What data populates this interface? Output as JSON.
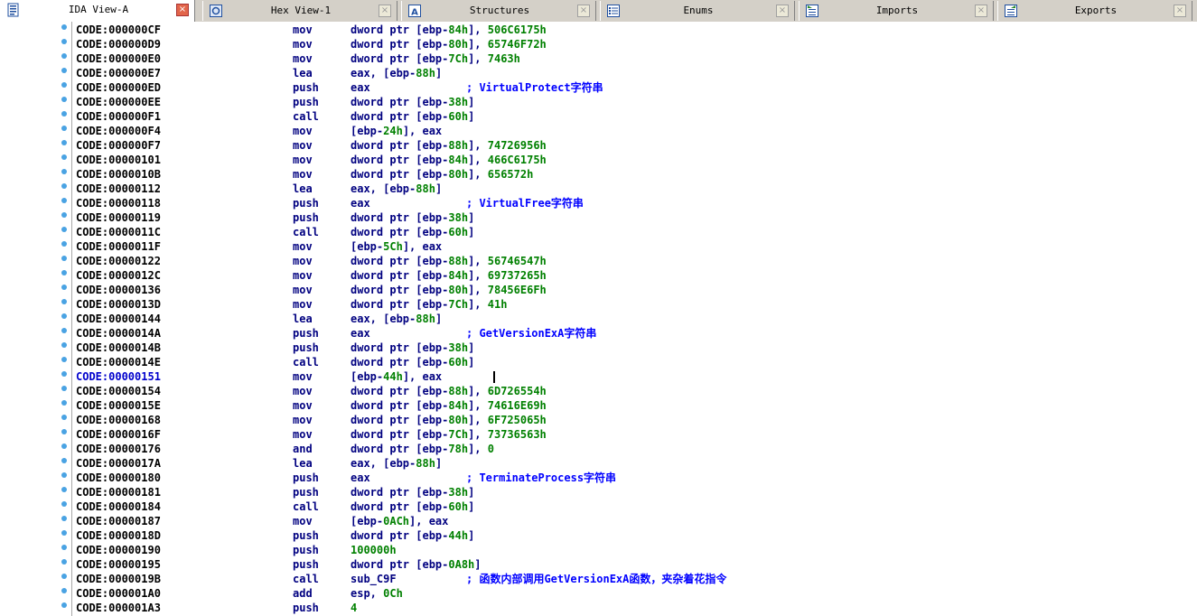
{
  "tabs": [
    {
      "label": "IDA View-A",
      "icon": "ida-view-icon",
      "active": true
    },
    {
      "label": "Hex View-1",
      "icon": "hex-view-icon",
      "active": false
    },
    {
      "label": "Structures",
      "icon": "structures-icon",
      "active": false
    },
    {
      "label": "Enums",
      "icon": "enums-icon",
      "active": false
    },
    {
      "label": "Imports",
      "icon": "imports-icon",
      "active": false
    },
    {
      "label": "Exports",
      "icon": "exports-icon",
      "active": false
    }
  ],
  "close_glyph": "×",
  "colors": {
    "address": "#000000",
    "selected_address": "#0000cc",
    "mnemonic": "#000080",
    "number": "#008000",
    "comment": "#0000ff",
    "bullet": "#4aa3e3"
  },
  "selected_row": 24,
  "rows": [
    {
      "addr": "CODE:000000CF",
      "mnem": "mov",
      "ops": [
        {
          "t": "dword ptr [ebp-",
          "k": "kw"
        },
        {
          "t": "84h",
          "k": "num"
        },
        {
          "t": "], ",
          "k": "kw"
        },
        {
          "t": "506C6175h",
          "k": "num"
        }
      ],
      "cmt": ""
    },
    {
      "addr": "CODE:000000D9",
      "mnem": "mov",
      "ops": [
        {
          "t": "dword ptr [ebp-",
          "k": "kw"
        },
        {
          "t": "80h",
          "k": "num"
        },
        {
          "t": "], ",
          "k": "kw"
        },
        {
          "t": "65746F72h",
          "k": "num"
        }
      ],
      "cmt": ""
    },
    {
      "addr": "CODE:000000E0",
      "mnem": "mov",
      "ops": [
        {
          "t": "dword ptr [ebp-",
          "k": "kw"
        },
        {
          "t": "7Ch",
          "k": "num"
        },
        {
          "t": "], ",
          "k": "kw"
        },
        {
          "t": "7463h",
          "k": "num"
        }
      ],
      "cmt": ""
    },
    {
      "addr": "CODE:000000E7",
      "mnem": "lea",
      "ops": [
        {
          "t": "eax, [ebp-",
          "k": "kw"
        },
        {
          "t": "88h",
          "k": "num"
        },
        {
          "t": "]",
          "k": "kw"
        }
      ],
      "cmt": ""
    },
    {
      "addr": "CODE:000000ED",
      "mnem": "push",
      "ops": [
        {
          "t": "eax",
          "k": "kw"
        }
      ],
      "cmt": "; VirtualProtect字符串"
    },
    {
      "addr": "CODE:000000EE",
      "mnem": "push",
      "ops": [
        {
          "t": "dword ptr [ebp-",
          "k": "kw"
        },
        {
          "t": "38h",
          "k": "num"
        },
        {
          "t": "]",
          "k": "kw"
        }
      ],
      "cmt": ""
    },
    {
      "addr": "CODE:000000F1",
      "mnem": "call",
      "ops": [
        {
          "t": "dword ptr [ebp-",
          "k": "kw"
        },
        {
          "t": "60h",
          "k": "num"
        },
        {
          "t": "]",
          "k": "kw"
        }
      ],
      "cmt": ""
    },
    {
      "addr": "CODE:000000F4",
      "mnem": "mov",
      "ops": [
        {
          "t": "[ebp-",
          "k": "kw"
        },
        {
          "t": "24h",
          "k": "num"
        },
        {
          "t": "], eax",
          "k": "kw"
        }
      ],
      "cmt": ""
    },
    {
      "addr": "CODE:000000F7",
      "mnem": "mov",
      "ops": [
        {
          "t": "dword ptr [ebp-",
          "k": "kw"
        },
        {
          "t": "88h",
          "k": "num"
        },
        {
          "t": "], ",
          "k": "kw"
        },
        {
          "t": "74726956h",
          "k": "num"
        }
      ],
      "cmt": ""
    },
    {
      "addr": "CODE:00000101",
      "mnem": "mov",
      "ops": [
        {
          "t": "dword ptr [ebp-",
          "k": "kw"
        },
        {
          "t": "84h",
          "k": "num"
        },
        {
          "t": "], ",
          "k": "kw"
        },
        {
          "t": "466C6175h",
          "k": "num"
        }
      ],
      "cmt": ""
    },
    {
      "addr": "CODE:0000010B",
      "mnem": "mov",
      "ops": [
        {
          "t": "dword ptr [ebp-",
          "k": "kw"
        },
        {
          "t": "80h",
          "k": "num"
        },
        {
          "t": "], ",
          "k": "kw"
        },
        {
          "t": "656572h",
          "k": "num"
        }
      ],
      "cmt": ""
    },
    {
      "addr": "CODE:00000112",
      "mnem": "lea",
      "ops": [
        {
          "t": "eax, [ebp-",
          "k": "kw"
        },
        {
          "t": "88h",
          "k": "num"
        },
        {
          "t": "]",
          "k": "kw"
        }
      ],
      "cmt": ""
    },
    {
      "addr": "CODE:00000118",
      "mnem": "push",
      "ops": [
        {
          "t": "eax",
          "k": "kw"
        }
      ],
      "cmt": "; VirtualFree字符串"
    },
    {
      "addr": "CODE:00000119",
      "mnem": "push",
      "ops": [
        {
          "t": "dword ptr [ebp-",
          "k": "kw"
        },
        {
          "t": "38h",
          "k": "num"
        },
        {
          "t": "]",
          "k": "kw"
        }
      ],
      "cmt": ""
    },
    {
      "addr": "CODE:0000011C",
      "mnem": "call",
      "ops": [
        {
          "t": "dword ptr [ebp-",
          "k": "kw"
        },
        {
          "t": "60h",
          "k": "num"
        },
        {
          "t": "]",
          "k": "kw"
        }
      ],
      "cmt": ""
    },
    {
      "addr": "CODE:0000011F",
      "mnem": "mov",
      "ops": [
        {
          "t": "[ebp-",
          "k": "kw"
        },
        {
          "t": "5Ch",
          "k": "num"
        },
        {
          "t": "], eax",
          "k": "kw"
        }
      ],
      "cmt": ""
    },
    {
      "addr": "CODE:00000122",
      "mnem": "mov",
      "ops": [
        {
          "t": "dword ptr [ebp-",
          "k": "kw"
        },
        {
          "t": "88h",
          "k": "num"
        },
        {
          "t": "], ",
          "k": "kw"
        },
        {
          "t": "56746547h",
          "k": "num"
        }
      ],
      "cmt": ""
    },
    {
      "addr": "CODE:0000012C",
      "mnem": "mov",
      "ops": [
        {
          "t": "dword ptr [ebp-",
          "k": "kw"
        },
        {
          "t": "84h",
          "k": "num"
        },
        {
          "t": "], ",
          "k": "kw"
        },
        {
          "t": "69737265h",
          "k": "num"
        }
      ],
      "cmt": ""
    },
    {
      "addr": "CODE:00000136",
      "mnem": "mov",
      "ops": [
        {
          "t": "dword ptr [ebp-",
          "k": "kw"
        },
        {
          "t": "80h",
          "k": "num"
        },
        {
          "t": "], ",
          "k": "kw"
        },
        {
          "t": "78456E6Fh",
          "k": "num"
        }
      ],
      "cmt": ""
    },
    {
      "addr": "CODE:0000013D",
      "mnem": "mov",
      "ops": [
        {
          "t": "dword ptr [ebp-",
          "k": "kw"
        },
        {
          "t": "7Ch",
          "k": "num"
        },
        {
          "t": "], ",
          "k": "kw"
        },
        {
          "t": "41h",
          "k": "num"
        }
      ],
      "cmt": ""
    },
    {
      "addr": "CODE:00000144",
      "mnem": "lea",
      "ops": [
        {
          "t": "eax, [ebp-",
          "k": "kw"
        },
        {
          "t": "88h",
          "k": "num"
        },
        {
          "t": "]",
          "k": "kw"
        }
      ],
      "cmt": ""
    },
    {
      "addr": "CODE:0000014A",
      "mnem": "push",
      "ops": [
        {
          "t": "eax",
          "k": "kw"
        }
      ],
      "cmt": "; GetVersionExA字符串"
    },
    {
      "addr": "CODE:0000014B",
      "mnem": "push",
      "ops": [
        {
          "t": "dword ptr [ebp-",
          "k": "kw"
        },
        {
          "t": "38h",
          "k": "num"
        },
        {
          "t": "]",
          "k": "kw"
        }
      ],
      "cmt": ""
    },
    {
      "addr": "CODE:0000014E",
      "mnem": "call",
      "ops": [
        {
          "t": "dword ptr [ebp-",
          "k": "kw"
        },
        {
          "t": "60h",
          "k": "num"
        },
        {
          "t": "]",
          "k": "kw"
        }
      ],
      "cmt": ""
    },
    {
      "addr": "CODE:00000151",
      "mnem": "mov",
      "ops": [
        {
          "t": "[ebp-",
          "k": "kw"
        },
        {
          "t": "44h",
          "k": "num"
        },
        {
          "t": "], eax",
          "k": "kw"
        }
      ],
      "cmt": ""
    },
    {
      "addr": "CODE:00000154",
      "mnem": "mov",
      "ops": [
        {
          "t": "dword ptr [ebp-",
          "k": "kw"
        },
        {
          "t": "88h",
          "k": "num"
        },
        {
          "t": "], ",
          "k": "kw"
        },
        {
          "t": "6D726554h",
          "k": "num"
        }
      ],
      "cmt": ""
    },
    {
      "addr": "CODE:0000015E",
      "mnem": "mov",
      "ops": [
        {
          "t": "dword ptr [ebp-",
          "k": "kw"
        },
        {
          "t": "84h",
          "k": "num"
        },
        {
          "t": "], ",
          "k": "kw"
        },
        {
          "t": "74616E69h",
          "k": "num"
        }
      ],
      "cmt": ""
    },
    {
      "addr": "CODE:00000168",
      "mnem": "mov",
      "ops": [
        {
          "t": "dword ptr [ebp-",
          "k": "kw"
        },
        {
          "t": "80h",
          "k": "num"
        },
        {
          "t": "], ",
          "k": "kw"
        },
        {
          "t": "6F725065h",
          "k": "num"
        }
      ],
      "cmt": ""
    },
    {
      "addr": "CODE:0000016F",
      "mnem": "mov",
      "ops": [
        {
          "t": "dword ptr [ebp-",
          "k": "kw"
        },
        {
          "t": "7Ch",
          "k": "num"
        },
        {
          "t": "], ",
          "k": "kw"
        },
        {
          "t": "73736563h",
          "k": "num"
        }
      ],
      "cmt": ""
    },
    {
      "addr": "CODE:00000176",
      "mnem": "and",
      "ops": [
        {
          "t": "dword ptr [ebp-",
          "k": "kw"
        },
        {
          "t": "78h",
          "k": "num"
        },
        {
          "t": "], ",
          "k": "kw"
        },
        {
          "t": "0",
          "k": "num"
        }
      ],
      "cmt": ""
    },
    {
      "addr": "CODE:0000017A",
      "mnem": "lea",
      "ops": [
        {
          "t": "eax, [ebp-",
          "k": "kw"
        },
        {
          "t": "88h",
          "k": "num"
        },
        {
          "t": "]",
          "k": "kw"
        }
      ],
      "cmt": ""
    },
    {
      "addr": "CODE:00000180",
      "mnem": "push",
      "ops": [
        {
          "t": "eax",
          "k": "kw"
        }
      ],
      "cmt": "; TerminateProcess字符串"
    },
    {
      "addr": "CODE:00000181",
      "mnem": "push",
      "ops": [
        {
          "t": "dword ptr [ebp-",
          "k": "kw"
        },
        {
          "t": "38h",
          "k": "num"
        },
        {
          "t": "]",
          "k": "kw"
        }
      ],
      "cmt": ""
    },
    {
      "addr": "CODE:00000184",
      "mnem": "call",
      "ops": [
        {
          "t": "dword ptr [ebp-",
          "k": "kw"
        },
        {
          "t": "60h",
          "k": "num"
        },
        {
          "t": "]",
          "k": "kw"
        }
      ],
      "cmt": ""
    },
    {
      "addr": "CODE:00000187",
      "mnem": "mov",
      "ops": [
        {
          "t": "[ebp-",
          "k": "kw"
        },
        {
          "t": "0ACh",
          "k": "num"
        },
        {
          "t": "], eax",
          "k": "kw"
        }
      ],
      "cmt": ""
    },
    {
      "addr": "CODE:0000018D",
      "mnem": "push",
      "ops": [
        {
          "t": "dword ptr [ebp-",
          "k": "kw"
        },
        {
          "t": "44h",
          "k": "num"
        },
        {
          "t": "]",
          "k": "kw"
        }
      ],
      "cmt": ""
    },
    {
      "addr": "CODE:00000190",
      "mnem": "push",
      "ops": [
        {
          "t": "100000h",
          "k": "num"
        }
      ],
      "cmt": ""
    },
    {
      "addr": "CODE:00000195",
      "mnem": "push",
      "ops": [
        {
          "t": "dword ptr [ebp-",
          "k": "kw"
        },
        {
          "t": "0A8h",
          "k": "num"
        },
        {
          "t": "]",
          "k": "kw"
        }
      ],
      "cmt": ""
    },
    {
      "addr": "CODE:0000019B",
      "mnem": "call",
      "ops": [
        {
          "t": "sub_C9F",
          "k": "kw"
        }
      ],
      "cmt": "; 函数内部调用GetVersionExA函数，夹杂着花指令"
    },
    {
      "addr": "CODE:000001A0",
      "mnem": "add",
      "ops": [
        {
          "t": "esp, ",
          "k": "kw"
        },
        {
          "t": "0Ch",
          "k": "num"
        }
      ],
      "cmt": ""
    },
    {
      "addr": "CODE:000001A3",
      "mnem": "push",
      "ops": [
        {
          "t": "4",
          "k": "num"
        }
      ],
      "cmt": ""
    }
  ]
}
